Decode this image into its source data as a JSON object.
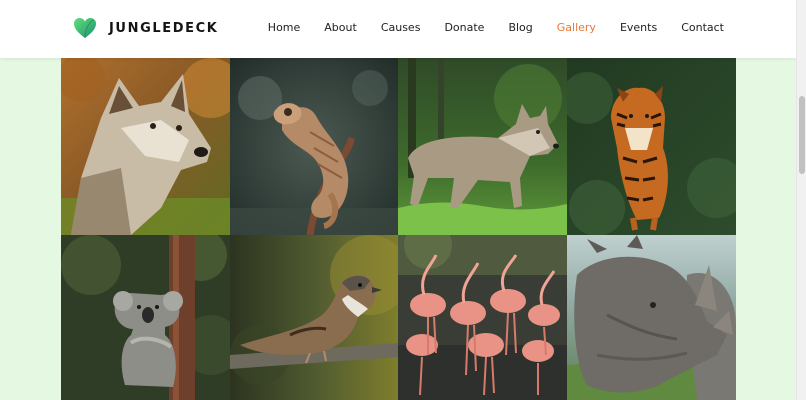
{
  "brand": {
    "name": "JUNGLEDECK",
    "logo_icon": "green-heart-logo-icon"
  },
  "nav": {
    "items": [
      "Home",
      "About",
      "Causes",
      "Donate",
      "Blog",
      "Gallery",
      "Events",
      "Contact"
    ],
    "active": "Gallery"
  },
  "gallery": {
    "images": [
      {
        "subject": "wolf-portrait",
        "icon": "wolf-photo"
      },
      {
        "subject": "chameleon",
        "icon": "chameleon-photo"
      },
      {
        "subject": "wolf-standing",
        "icon": "wolf-photo"
      },
      {
        "subject": "tiger",
        "icon": "tiger-photo"
      },
      {
        "subject": "koala",
        "icon": "koala-photo"
      },
      {
        "subject": "sparrow",
        "icon": "sparrow-photo"
      },
      {
        "subject": "flamingos",
        "icon": "flamingo-photo"
      },
      {
        "subject": "rhinoceros",
        "icon": "rhino-photo"
      }
    ]
  },
  "colors": {
    "accent": "#e87736",
    "page_background": "#e4f8e2",
    "header_background": "#ffffff",
    "logo_green": "#3dbb72"
  }
}
